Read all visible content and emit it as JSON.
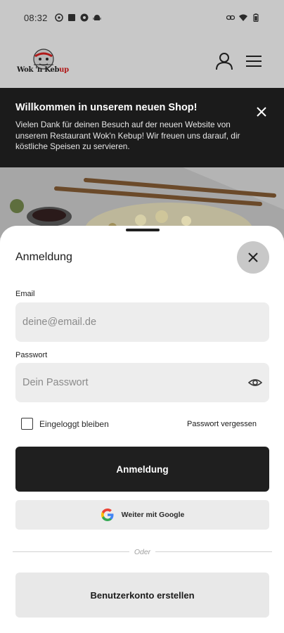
{
  "status_bar": {
    "time": "08:32",
    "left_icons": [
      "messenger-icon",
      "square-app-icon",
      "vpn-key-icon",
      "android-icon"
    ],
    "right_icons": [
      "link-icon",
      "wifi-icon",
      "battery-icon"
    ]
  },
  "header": {
    "logo_text_main": "Wok 'n Keb",
    "logo_text_accent": "up",
    "icons": [
      "user-icon",
      "menu-icon"
    ]
  },
  "banner": {
    "title": "Willkommen in unserem neuen Shop!",
    "text": "Vielen Dank für deinen Besuch auf der neuen Website von unserem Restaurant Wok'n Kebup! Wir freuen uns darauf, dir köstliche Speisen zu servieren."
  },
  "login": {
    "title": "Anmeldung",
    "email_label": "Email",
    "email_placeholder": "deine@email.de",
    "password_label": "Passwort",
    "password_placeholder": "Dein Passwort",
    "remember_label": "Eingeloggt bleiben",
    "forgot_label": "Passwort vergessen",
    "submit_label": "Anmeldung",
    "google_label": "Weiter mit Google",
    "divider_label": "Oder",
    "create_account_label": "Benutzerkonto erstellen"
  },
  "colors": {
    "primary_button": "#1f1f1f",
    "overlay": "#c8c8c8",
    "banner_bg": "#1b1b1b",
    "logo_accent": "#b01a1a"
  }
}
